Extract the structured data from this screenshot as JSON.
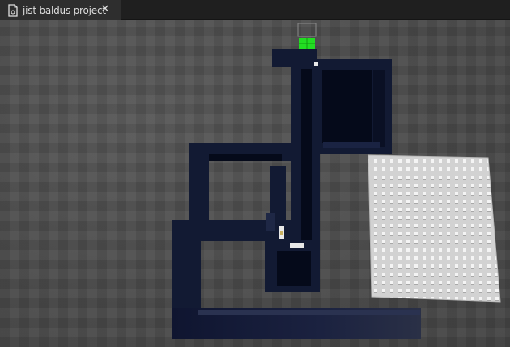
{
  "tab": {
    "title": "jist baldus project",
    "close_glyph": "✕",
    "file_icon": "document-icon"
  },
  "viewport": {
    "label": "3d-scene-viewport"
  },
  "scene": {
    "wall_color": "#121a33",
    "floor_color": "#050a1a",
    "highlight_color": "#e8e8e8",
    "goal_color": "#22dd22",
    "baseplate_color": "#cfcfcf"
  }
}
